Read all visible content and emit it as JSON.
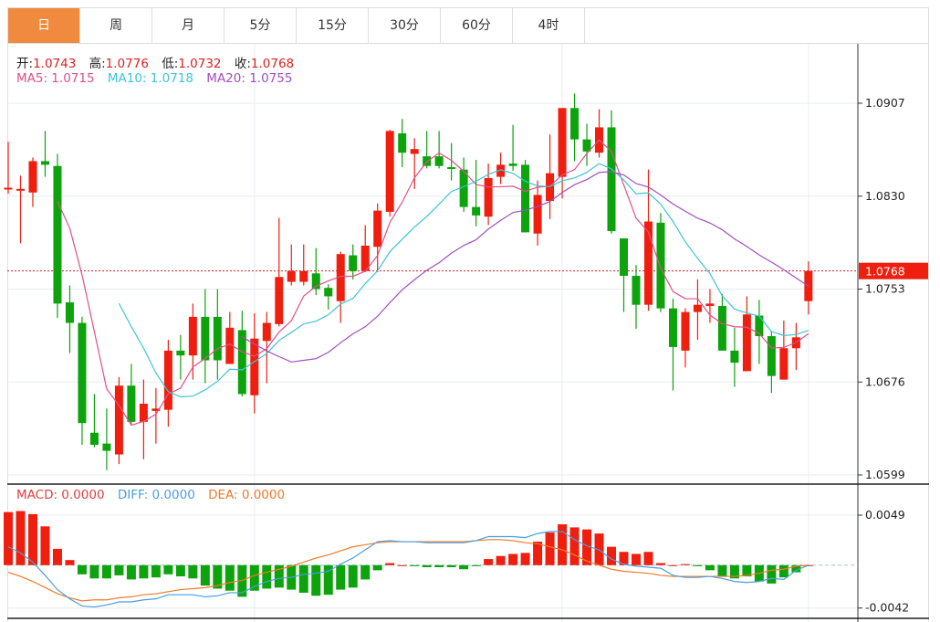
{
  "tabs": [
    "日",
    "周",
    "月",
    "5分",
    "15分",
    "30分",
    "60分",
    "4时"
  ],
  "active_tab": 0,
  "ohlc_legend": {
    "open_label": "开:",
    "open": "1.0743",
    "high_label": "高:",
    "high": "1.0776",
    "low_label": "低:",
    "low": "1.0732",
    "close_label": "收:",
    "close": "1.0768"
  },
  "ma_legend": {
    "ma5": "MA5: 1.0715",
    "ma10": "MA10: 1.0718",
    "ma20": "MA20: 1.0755"
  },
  "macd_legend": {
    "macd": "MACD: 0.0000",
    "diff": "DIFF: 0.0000",
    "dea": "DEA: 0.0000"
  },
  "colors": {
    "up": "#f01e0e",
    "down": "#0ca30c",
    "ma5": "#e0508a",
    "ma10": "#3cc4d8",
    "ma20": "#a24fc0",
    "diff": "#4a9ee0",
    "dea": "#f07a2a",
    "accent": "#f08a3e"
  },
  "chart_data": [
    {
      "type": "candlestick",
      "title": "",
      "y_ticks": [
        "1.0907",
        "1.0830",
        "1.0753",
        "1.0676",
        "1.0599"
      ],
      "ylim": [
        1.0599,
        1.0907
      ],
      "last_price": "1.0768",
      "ohlc": [
        [
          1.0836,
          1.0875,
          1.0832,
          1.0837
        ],
        [
          1.0836,
          1.0847,
          1.0791,
          1.0836
        ],
        [
          1.0833,
          1.0862,
          1.0821,
          1.0859
        ],
        [
          1.0859,
          1.0884,
          1.0846,
          1.0856
        ],
        [
          1.0855,
          1.0865,
          1.0729,
          1.0741
        ],
        [
          1.0742,
          1.0756,
          1.07,
          1.0725
        ],
        [
          1.0725,
          1.073,
          1.0624,
          1.0642
        ],
        [
          1.0634,
          1.0666,
          1.0622,
          1.0624
        ],
        [
          1.0625,
          1.0654,
          1.0603,
          1.0619
        ],
        [
          1.0616,
          1.068,
          1.0608,
          1.0673
        ],
        [
          1.0673,
          1.0691,
          1.0641,
          1.0643
        ],
        [
          1.0643,
          1.0678,
          1.0612,
          1.0658
        ],
        [
          1.0652,
          1.0671,
          1.0625,
          1.0654
        ],
        [
          1.0653,
          1.0711,
          1.0639,
          1.0702
        ],
        [
          1.0702,
          1.0715,
          1.0678,
          1.0698
        ],
        [
          1.0698,
          1.0741,
          1.0678,
          1.073
        ],
        [
          1.073,
          1.0753,
          1.0675,
          1.0694
        ],
        [
          1.073,
          1.0753,
          1.0678,
          1.0694
        ],
        [
          1.0691,
          1.0734,
          1.0691,
          1.0721
        ],
        [
          1.0719,
          1.0735,
          1.0664,
          1.0666
        ],
        [
          1.0665,
          1.0733,
          1.065,
          1.0712
        ],
        [
          1.071,
          1.0734,
          1.0675,
          1.0725
        ],
        [
          1.0724,
          1.0812,
          1.0722,
          1.0763
        ],
        [
          1.0759,
          1.079,
          1.0756,
          1.0768
        ],
        [
          1.0759,
          1.079,
          1.0756,
          1.0768
        ],
        [
          1.0766,
          1.0787,
          1.0748,
          1.0753
        ],
        [
          1.0754,
          1.0757,
          1.0736,
          1.0747
        ],
        [
          1.0743,
          1.0784,
          1.0725,
          1.0782
        ],
        [
          1.0781,
          1.079,
          1.0761,
          1.0768
        ],
        [
          1.0768,
          1.0806,
          1.0767,
          1.0789
        ],
        [
          1.0788,
          1.0824,
          1.0767,
          1.0818
        ],
        [
          1.0817,
          1.0885,
          1.0813,
          1.0884
        ],
        [
          1.0882,
          1.0894,
          1.0854,
          1.0866
        ],
        [
          1.0865,
          1.0878,
          1.0836,
          1.0869
        ],
        [
          1.0863,
          1.0884,
          1.0853,
          1.0855
        ],
        [
          1.0863,
          1.0884,
          1.0853,
          1.0855
        ],
        [
          1.0854,
          1.0874,
          1.0843,
          1.0853
        ],
        [
          1.0852,
          1.0862,
          1.0817,
          1.0821
        ],
        [
          1.0821,
          1.086,
          1.0805,
          1.0814
        ],
        [
          1.0813,
          1.0857,
          1.0806,
          1.0845
        ],
        [
          1.0846,
          1.0866,
          1.084,
          1.0856
        ],
        [
          1.0857,
          1.0889,
          1.0851,
          1.0855
        ],
        [
          1.0856,
          1.086,
          1.08,
          1.08
        ],
        [
          1.0799,
          1.0843,
          1.0789,
          1.0831
        ],
        [
          1.0826,
          1.0881,
          1.0811,
          1.0849
        ],
        [
          1.0846,
          1.0903,
          1.0828,
          1.0903
        ],
        [
          1.0903,
          1.0915,
          1.0859,
          1.0877
        ],
        [
          1.0877,
          1.089,
          1.0855,
          1.0867
        ],
        [
          1.0866,
          1.0902,
          1.0862,
          1.0887
        ],
        [
          1.0887,
          1.0901,
          1.0799,
          1.0801
        ],
        [
          1.0795,
          1.0795,
          1.0734,
          1.0764
        ],
        [
          1.0764,
          1.0773,
          1.072,
          1.074
        ],
        [
          1.074,
          1.0852,
          1.0735,
          1.0809
        ],
        [
          1.0808,
          1.0816,
          1.0734,
          1.0737
        ],
        [
          1.0737,
          1.0745,
          1.0669,
          1.0705
        ],
        [
          1.0702,
          1.0737,
          1.0688,
          1.0734
        ],
        [
          1.0734,
          1.0761,
          1.0711,
          1.074
        ],
        [
          1.0739,
          1.0753,
          1.0725,
          1.0741
        ],
        [
          1.0739,
          1.0749,
          1.0702,
          1.0702
        ],
        [
          1.0702,
          1.0721,
          1.0672,
          1.0692
        ],
        [
          1.0685,
          1.0747,
          1.0685,
          1.0732
        ],
        [
          1.0731,
          1.0744,
          1.0691,
          1.0714
        ],
        [
          1.0714,
          1.0718,
          1.0667,
          1.0681
        ],
        [
          1.0678,
          1.0727,
          1.0678,
          1.0704
        ],
        [
          1.0704,
          1.0725,
          1.0686,
          1.0713
        ],
        [
          1.0743,
          1.0776,
          1.0732,
          1.0768
        ]
      ],
      "ma_periods": [
        5,
        10,
        20
      ]
    },
    {
      "type": "bar+line",
      "title": "MACD",
      "y_ticks": [
        "0.0049",
        "-0.0042"
      ],
      "ylim": [
        -0.0042,
        0.0049
      ],
      "macd": [
        0.0052,
        0.0053,
        0.005,
        0.0038,
        0.0016,
        0.0005,
        -0.0009,
        -0.0013,
        -0.0013,
        -0.001,
        -0.0014,
        -0.0013,
        -0.0012,
        -0.0009,
        -0.0011,
        -0.0013,
        -0.002,
        -0.0023,
        -0.0025,
        -0.0031,
        -0.0025,
        -0.0023,
        -0.0022,
        -0.0024,
        -0.0027,
        -0.003,
        -0.0029,
        -0.0024,
        -0.0022,
        -0.0014,
        -0.0005,
        0.0002,
        0.0,
        -0.0001,
        -0.0002,
        -0.0002,
        -0.0002,
        -0.0004,
        -0.0001,
        0.0006,
        0.0009,
        0.0011,
        0.0012,
        0.0023,
        0.0032,
        0.004,
        0.0037,
        0.0035,
        0.0031,
        0.0018,
        0.0013,
        0.0011,
        0.0013,
        0.0002,
        0.0,
        0.0001,
        -0.0001,
        -0.0005,
        -0.0011,
        -0.0013,
        -0.0011,
        -0.0016,
        -0.0018,
        -0.0012,
        -0.0007,
        0.0
      ],
      "diff": [
        0.0018,
        0.0012,
        0.0003,
        -0.001,
        -0.0024,
        -0.0033,
        -0.004,
        -0.0041,
        -0.0039,
        -0.0036,
        -0.0036,
        -0.0034,
        -0.0033,
        -0.0029,
        -0.0029,
        -0.0029,
        -0.0031,
        -0.003,
        -0.0027,
        -0.0027,
        -0.0021,
        -0.0016,
        -0.0013,
        -0.0012,
        -0.0009,
        -0.0008,
        -0.0006,
        0.0001,
        0.0007,
        0.0015,
        0.0023,
        0.0024,
        0.0023,
        0.0023,
        0.0022,
        0.0022,
        0.0022,
        0.0022,
        0.0024,
        0.0028,
        0.0028,
        0.0028,
        0.0027,
        0.0031,
        0.0033,
        0.0033,
        0.0025,
        0.0019,
        0.0015,
        0.0006,
        0.0001,
        -0.0001,
        -0.0002,
        -0.0003,
        -0.001,
        -0.0012,
        -0.0012,
        -0.0011,
        -0.0013,
        -0.0016,
        -0.0017,
        -0.0016,
        -0.0013,
        -0.0014,
        -0.0005,
        0.0
      ],
      "dea": [
        -0.0007,
        -0.0011,
        -0.0016,
        -0.0022,
        -0.0028,
        -0.0032,
        -0.0035,
        -0.0034,
        -0.0034,
        -0.0032,
        -0.0031,
        -0.0029,
        -0.0028,
        -0.0026,
        -0.0024,
        -0.0023,
        -0.0022,
        -0.002,
        -0.0017,
        -0.0015,
        -0.001,
        -0.0007,
        -0.0004,
        -0.0001,
        0.0003,
        0.0007,
        0.001,
        0.0014,
        0.0018,
        0.002,
        0.0022,
        0.0023,
        0.0023,
        0.0023,
        0.0023,
        0.0023,
        0.0023,
        0.0023,
        0.0024,
        0.0025,
        0.0025,
        0.0024,
        0.0022,
        0.0021,
        0.0018,
        0.0015,
        0.001,
        0.0004,
        0.0,
        -0.0004,
        -0.0006,
        -0.0007,
        -0.0008,
        -0.001,
        -0.0011,
        -0.0011,
        -0.0011,
        -0.0011,
        -0.0011,
        -0.0011,
        -0.001,
        -0.0008,
        -0.0005,
        -0.0004,
        -0.0001,
        0.0
      ]
    }
  ]
}
